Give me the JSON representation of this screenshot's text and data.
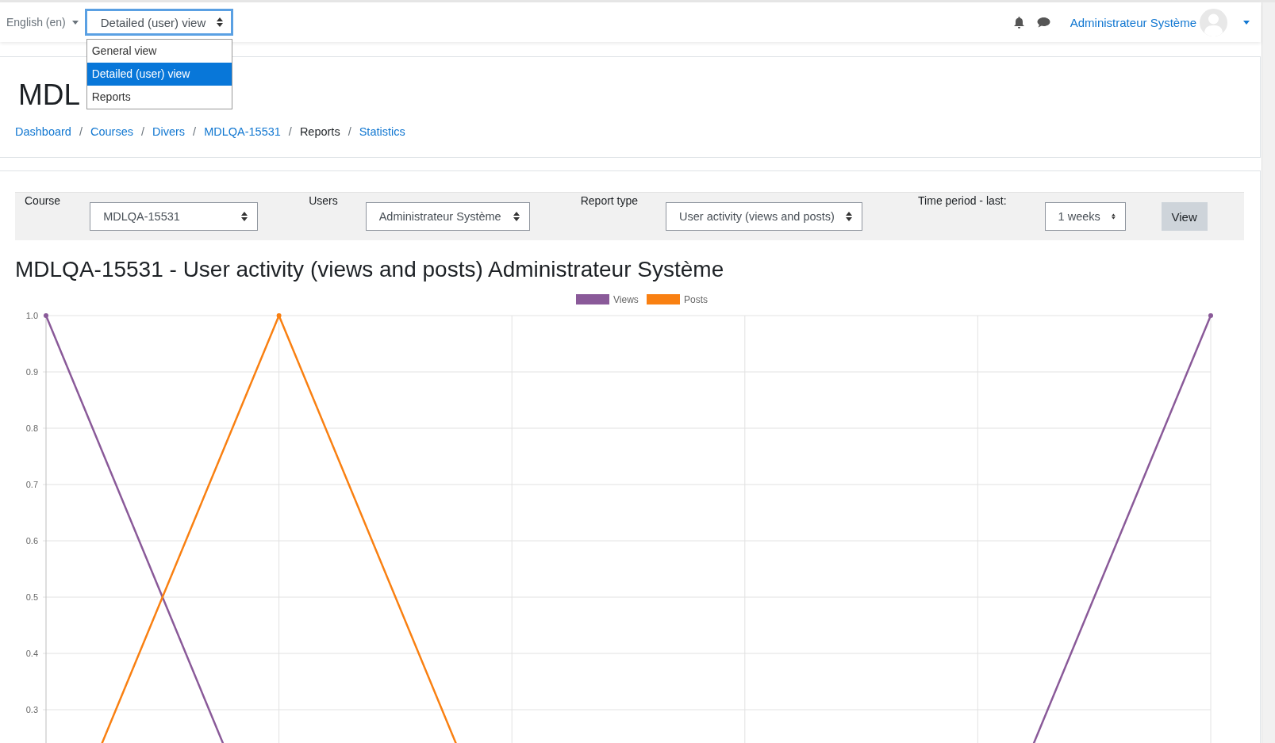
{
  "navbar": {
    "language": "English (en)",
    "view_select": {
      "value": "Detailed (user) view",
      "focused": true
    },
    "user_name": "Administrateur Système"
  },
  "view_menu": [
    {
      "label": "General view",
      "selected": false
    },
    {
      "label": "Detailed (user) view",
      "selected": true
    },
    {
      "label": "Reports",
      "selected": false
    }
  ],
  "page_title": "MDL",
  "breadcrumb": [
    {
      "label": "Dashboard",
      "link": true
    },
    {
      "separator": "/",
      "label": "Courses",
      "link": true
    },
    {
      "separator": "/",
      "label": "Divers",
      "link": true
    },
    {
      "separator": "/",
      "label": "MDLQA-15531",
      "link": true
    },
    {
      "separator": "/",
      "label": "Reports",
      "link": false
    },
    {
      "separator": "/",
      "label": "Statistics",
      "link": true
    }
  ],
  "filters": [
    {
      "label": "Course",
      "value": "MDLQA-15531"
    },
    {
      "label": "Users",
      "value": "Administrateur Système"
    },
    {
      "label": "Report type",
      "value": "User activity (views and posts)"
    },
    {
      "label": "Time period - last:",
      "value": "1 weeks"
    }
  ],
  "view_button": "View",
  "report_title": "MDLQA-15531 - User activity (views and posts) Administrateur Système",
  "chart_data": {
    "type": "line",
    "grid": true,
    "legend": "top",
    "categories": [
      null,
      null,
      null,
      null,
      null,
      null
    ],
    "ylim": [
      0,
      1
    ],
    "yticks": [
      {
        "value": 0.3,
        "label": "0.3"
      },
      {
        "value": 0.4,
        "label": "0.4"
      },
      {
        "value": 0.5,
        "label": "0.5"
      },
      {
        "value": 0.6,
        "label": "0.6"
      },
      {
        "value": 0.7,
        "label": "0.7"
      },
      {
        "value": 0.8,
        "label": "0.8"
      },
      {
        "value": 0.9,
        "label": "0.9"
      },
      {
        "value": 1.0,
        "label": "1.0"
      }
    ],
    "series": [
      {
        "name": "Views",
        "color": "#8a5a99",
        "marker": true,
        "values": [
          1,
          0,
          null,
          null,
          0,
          1
        ]
      },
      {
        "name": "Posts",
        "color": "#f98012",
        "marker": true,
        "values": [
          0,
          1,
          0,
          null,
          null,
          null
        ]
      }
    ]
  }
}
